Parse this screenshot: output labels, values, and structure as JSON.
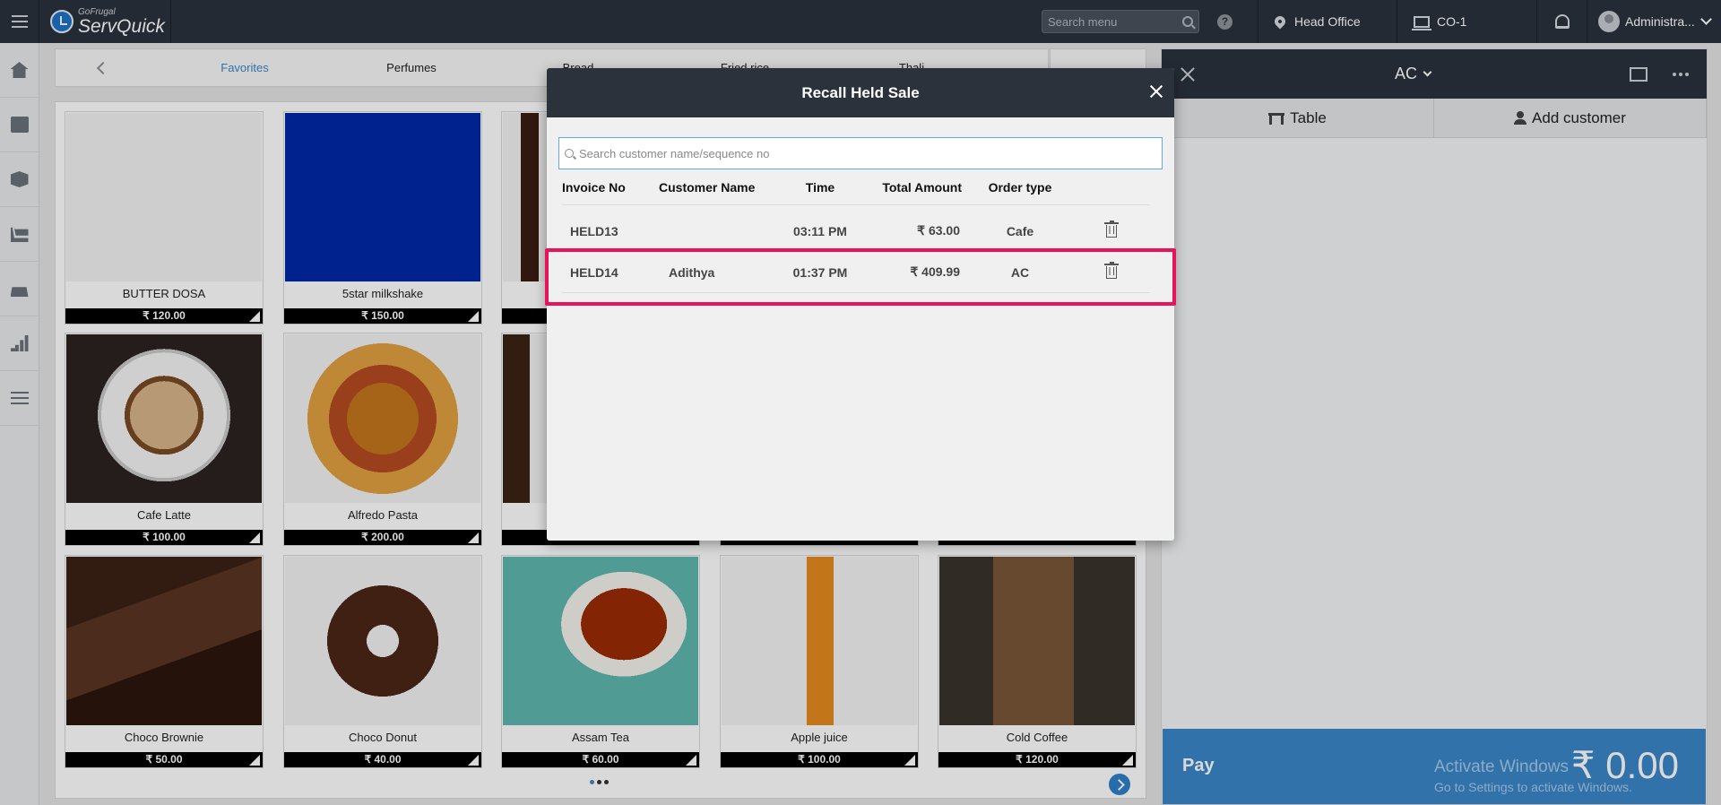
{
  "app": {
    "logo_small": "GoFrugal",
    "logo_big": "ServQuick"
  },
  "topbar": {
    "search_placeholder": "Search menu",
    "help": "?",
    "location": "Head Office",
    "counter": "CO-1",
    "user": "Administra..."
  },
  "categories": [
    "Favorites",
    "Perfumes",
    "Bread",
    "Fried rice",
    "Thali"
  ],
  "products": [
    {
      "name": "BUTTER DOSA",
      "price": "₹ 120.00",
      "image": "blank"
    },
    {
      "name": "5star milkshake",
      "price": "₹ 150.00",
      "image": "blue"
    },
    {
      "name": "",
      "price": "",
      "image": "cola"
    },
    {
      "name": "",
      "price": "",
      "image": ""
    },
    {
      "name": "",
      "price": "",
      "image": ""
    },
    {
      "name": "Cafe Latte",
      "price": "₹ 100.00",
      "image": "latte"
    },
    {
      "name": "Alfredo Pasta",
      "price": "₹ 200.00",
      "image": "pasta"
    },
    {
      "name": "",
      "price": "",
      "image": "coffee-beans"
    },
    {
      "name": "",
      "price": "",
      "image": ""
    },
    {
      "name": "",
      "price": "",
      "image": ""
    },
    {
      "name": "Choco Brownie",
      "price": "₹ 50.00",
      "image": "brownie"
    },
    {
      "name": "Choco Donut",
      "price": "₹ 40.00",
      "image": "donut"
    },
    {
      "name": "Assam Tea",
      "price": "₹ 60.00",
      "image": "tea"
    },
    {
      "name": "Apple juice",
      "price": "₹ 100.00",
      "image": "juice"
    },
    {
      "name": "Cold Coffee",
      "price": "₹ 120.00",
      "image": "cold-coffee"
    }
  ],
  "order": {
    "title": "AC",
    "tab_table": "Table",
    "tab_customer": "Add customer",
    "pay_label": "Pay",
    "amount": "₹ 0.00",
    "activate": "Activate Windows",
    "activate_sub": "Go to Settings to activate Windows."
  },
  "modal": {
    "title": "Recall Held Sale",
    "search_placeholder": "Search customer name/sequence no",
    "columns": {
      "invoice": "Invoice No",
      "customer": "Customer Name",
      "time": "Time",
      "amount": "Total Amount",
      "type": "Order type"
    },
    "rows": [
      {
        "invoice": "HELD13",
        "customer": "",
        "time": "03:11 PM",
        "amount": "₹ 63.00",
        "type": "Cafe"
      },
      {
        "invoice": "HELD14",
        "customer": "Adithya",
        "time": "01:37 PM",
        "amount": "₹ 409.99",
        "type": "AC"
      }
    ]
  },
  "colors": {
    "accent": "#3a87c9",
    "highlight": "#e8135a",
    "header": "#2b323c"
  },
  "icons": [
    "menu-icon",
    "search-icon",
    "help-icon",
    "location-pin-icon",
    "monitor-icon",
    "bell-icon",
    "user-avatar-icon",
    "home-icon",
    "book-icon",
    "box-icon",
    "cart-icon",
    "till-icon",
    "chart-icon",
    "sliders-icon",
    "close-icon",
    "table-icon",
    "person-icon",
    "scan-icon",
    "more-icon",
    "trash-icon"
  ]
}
